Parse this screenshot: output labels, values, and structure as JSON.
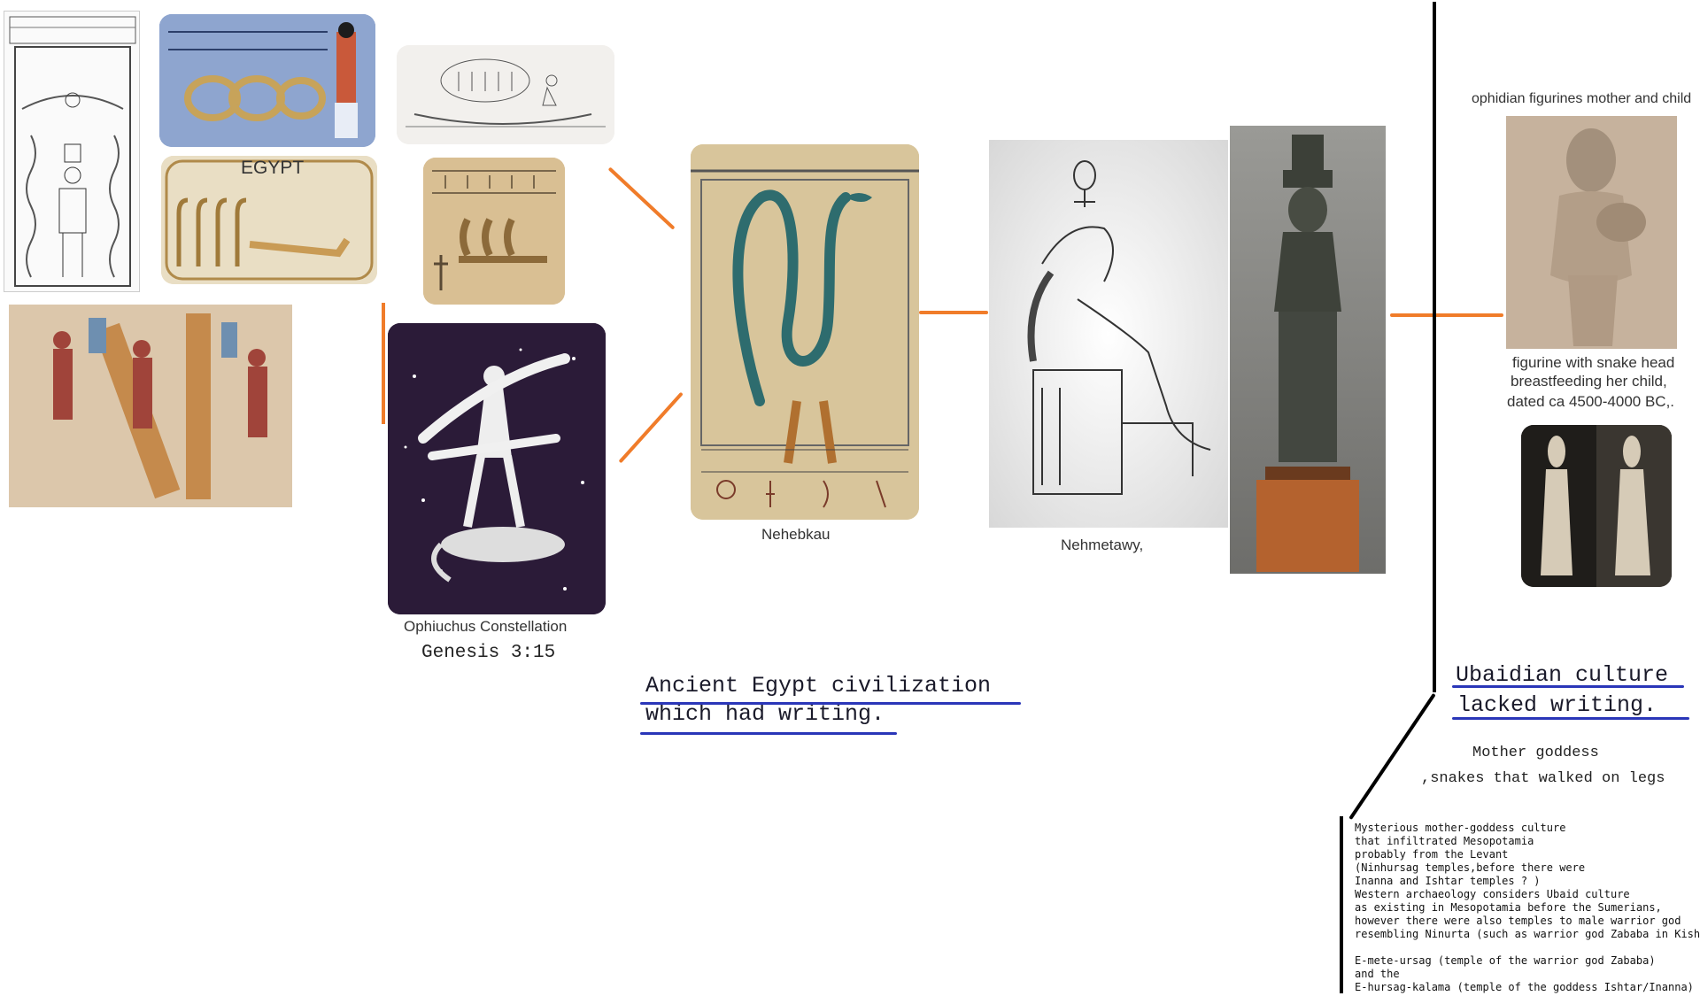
{
  "labels": {
    "egypt": "EGYPT",
    "nehebkau": "Nehebkau",
    "nehmetawy": "Nehmetawy,",
    "ophiuchus": "Ophiuchus Constellation",
    "genesis": "Genesis 3:15",
    "ophidian_title": "ophidian figurines mother and child",
    "figurine_caption_1": "figurine with snake head",
    "figurine_caption_2": "breastfeeding her child,",
    "figurine_caption_3": "dated ca 4500-4000 BC,."
  },
  "headings": {
    "egypt_line1": "Ancient Egypt civilization",
    "egypt_line2": "which had writing.",
    "ubaid_line1": "Ubaidian culture",
    "ubaid_line2": "lacked writing."
  },
  "mother_goddess": {
    "line1": "Mother goddess",
    "line2": ",snakes that walked on legs"
  },
  "notes": "Mysterious mother-goddess culture\nthat infiltrated Mesopotamia\nprobably from the Levant\n(Ninhursag temples,before there were\nInanna and Ishtar temples ? )\nWestern archaeology considers Ubaid culture\nas existing in Mesopotamia before the Sumerians,\nhowever there were also temples to male warrior god\nresembling Ninurta (such as warrior god Zababa in Kish)\n\nE-mete-ursag (temple of the warrior god Zababa)\nand the\nE-hursag-kalama (temple of the goddess Ishtar/Inanna)",
  "colors": {
    "accent_orange": "#f07c2a",
    "underline_blue": "#2a36b8",
    "divider": "#000000"
  }
}
